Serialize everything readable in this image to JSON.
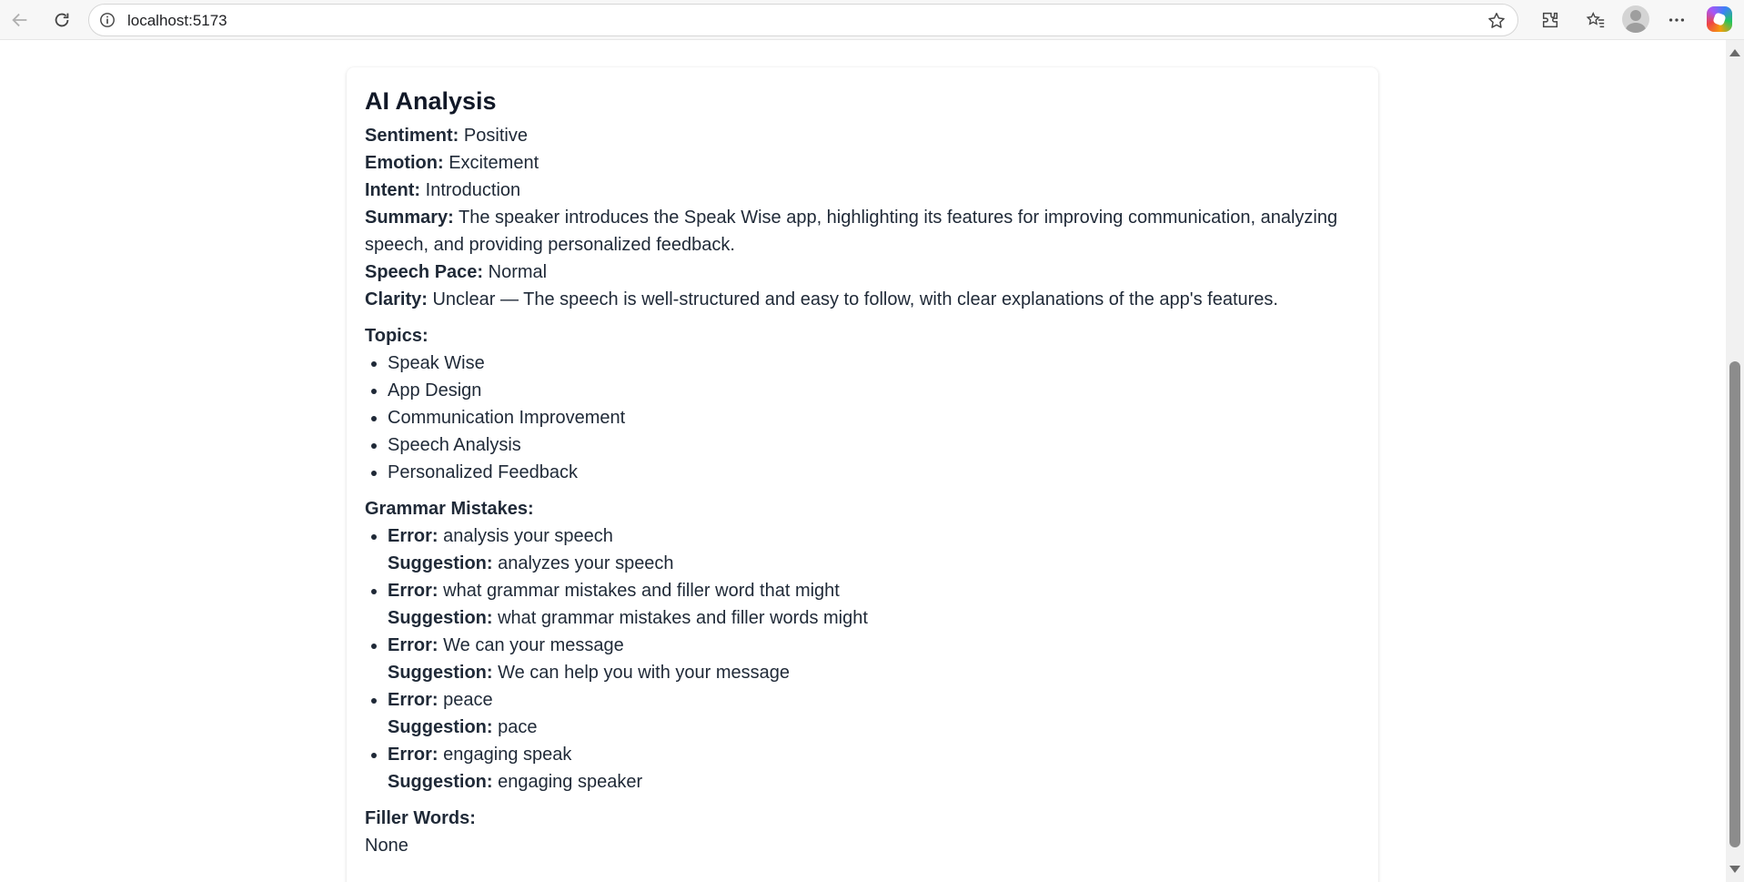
{
  "browser": {
    "url": "localhost:5173"
  },
  "analysis": {
    "title": "AI Analysis",
    "sentiment_label": "Sentiment:",
    "sentiment": "Positive",
    "emotion_label": "Emotion:",
    "emotion": "Excitement",
    "intent_label": "Intent:",
    "intent": "Introduction",
    "summary_label": "Summary:",
    "summary": "The speaker introduces the Speak Wise app, highlighting its features for improving communication, analyzing speech, and providing personalized feedback.",
    "pace_label": "Speech Pace:",
    "pace": "Normal",
    "clarity_label": "Clarity:",
    "clarity": "Unclear — The speech is well-structured and easy to follow, with clear explanations of the app's features.",
    "topics_label": "Topics:",
    "topics": [
      "Speak Wise",
      "App Design",
      "Communication Improvement",
      "Speech Analysis",
      "Personalized Feedback"
    ],
    "grammar_label": "Grammar Mistakes:",
    "error_label": "Error:",
    "suggestion_label": "Suggestion:",
    "grammar": [
      {
        "error": "analysis your speech",
        "suggestion": "analyzes your speech"
      },
      {
        "error": "what grammar mistakes and filler word that might",
        "suggestion": "what grammar mistakes and filler words might"
      },
      {
        "error": "We can your message",
        "suggestion": "We can help you with your message"
      },
      {
        "error": "peace",
        "suggestion": "pace"
      },
      {
        "error": "engaging speak",
        "suggestion": "engaging speaker"
      }
    ],
    "filler_label": "Filler Words:",
    "filler": "None"
  }
}
